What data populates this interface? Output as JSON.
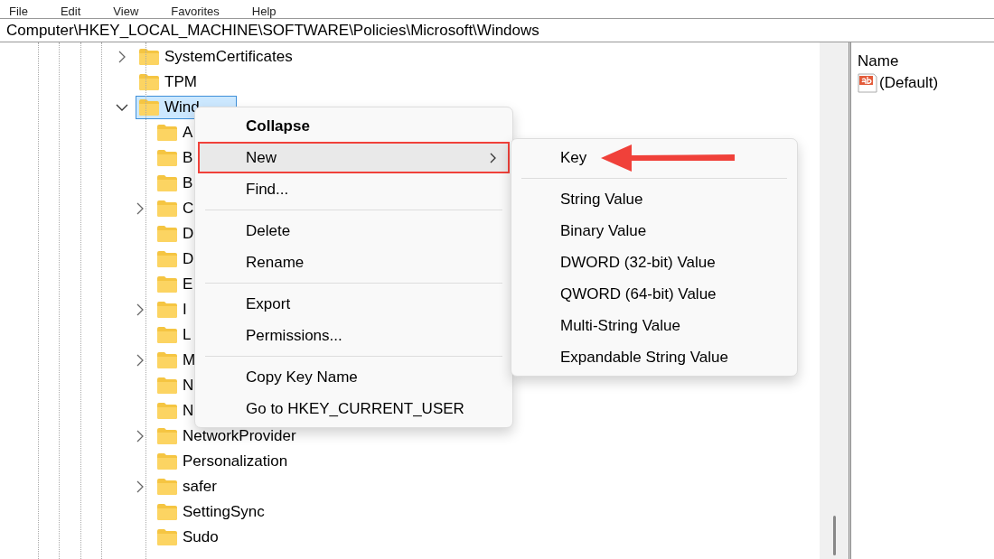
{
  "menu_bar": [
    "File",
    "Edit",
    "View",
    "Favorites",
    "Help"
  ],
  "address_bar": {
    "value": "Computer\\HKEY_LOCAL_MACHINE\\SOFTWARE\\Policies\\Microsoft\\Windows"
  },
  "tree": [
    {
      "label": "SystemCertificates",
      "expanded": false,
      "selected": false
    },
    {
      "label": "TPM",
      "selected": false
    },
    {
      "label": "Wind",
      "expanded": true,
      "selected": true,
      "children": [
        {
          "label": "A",
          "selected": false
        },
        {
          "label": "B",
          "selected": false
        },
        {
          "label": "B",
          "selected": false
        },
        {
          "label": "C",
          "expanded": false,
          "selected": false
        },
        {
          "label": "D",
          "selected": false
        },
        {
          "label": "D",
          "selected": false
        },
        {
          "label": "E",
          "selected": false
        },
        {
          "label": "I",
          "expanded": false,
          "selected": false
        },
        {
          "label": "L",
          "selected": false
        },
        {
          "label": "M",
          "expanded": false,
          "selected": false
        },
        {
          "label": "N",
          "selected": false
        },
        {
          "label": "N",
          "selected": false
        },
        {
          "label": "NetworkProvider",
          "expanded": false,
          "selected": false
        },
        {
          "label": "Personalization",
          "selected": false
        },
        {
          "label": "safer",
          "expanded": false,
          "selected": false
        },
        {
          "label": "SettingSync",
          "selected": false
        },
        {
          "label": "Sudo",
          "selected": false
        }
      ]
    }
  ],
  "values_pane": {
    "column": "Name",
    "rows": [
      {
        "name": "(Default)"
      }
    ]
  },
  "context_menu": [
    {
      "kind": "item",
      "label": "Collapse",
      "bold": true,
      "selected": false,
      "submenu": false,
      "outlined": false
    },
    {
      "kind": "item",
      "label": "New",
      "bold": false,
      "selected": true,
      "submenu": true,
      "outlined": true
    },
    {
      "kind": "item",
      "label": "Find...",
      "bold": false,
      "selected": false,
      "submenu": false,
      "outlined": false
    },
    {
      "kind": "separator"
    },
    {
      "kind": "item",
      "label": "Delete",
      "bold": false,
      "selected": false,
      "submenu": false,
      "outlined": false
    },
    {
      "kind": "item",
      "label": "Rename",
      "bold": false,
      "selected": false,
      "submenu": false,
      "outlined": false
    },
    {
      "kind": "separator"
    },
    {
      "kind": "item",
      "label": "Export",
      "bold": false,
      "selected": false,
      "submenu": false,
      "outlined": false
    },
    {
      "kind": "item",
      "label": "Permissions...",
      "bold": false,
      "selected": false,
      "submenu": false,
      "outlined": false
    },
    {
      "kind": "separator"
    },
    {
      "kind": "item",
      "label": "Copy Key Name",
      "bold": false,
      "selected": false,
      "submenu": false,
      "outlined": false
    },
    {
      "kind": "item",
      "label": "Go to HKEY_CURRENT_USER",
      "bold": false,
      "selected": false,
      "submenu": false,
      "outlined": false
    }
  ],
  "submenu": [
    {
      "kind": "item",
      "label": "Key",
      "pointed": true
    },
    {
      "kind": "separator"
    },
    {
      "kind": "item",
      "label": "String Value",
      "pointed": false
    },
    {
      "kind": "item",
      "label": "Binary Value",
      "pointed": false
    },
    {
      "kind": "item",
      "label": "DWORD (32-bit) Value",
      "pointed": false
    },
    {
      "kind": "item",
      "label": "QWORD (64-bit) Value",
      "pointed": false
    },
    {
      "kind": "item",
      "label": "Multi-String Value",
      "pointed": false
    },
    {
      "kind": "item",
      "label": "Expandable String Value",
      "pointed": false
    }
  ]
}
